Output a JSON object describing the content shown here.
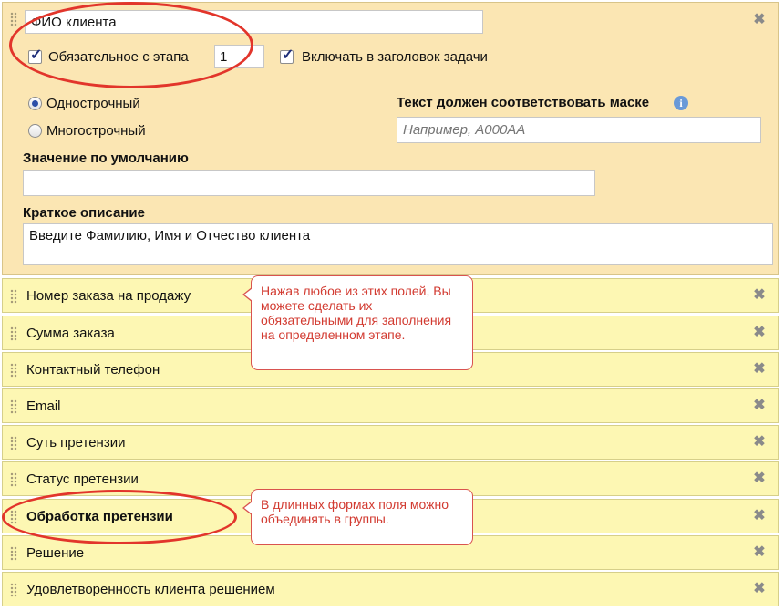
{
  "main_field": {
    "name": "ФИО клиента",
    "required_label": "Обязательное с этапа",
    "required_checked": true,
    "stage_value": "1",
    "include_title_label": "Включать в заголовок задачи",
    "include_title_checked": true,
    "single_line_label": "Однострочный",
    "multi_line_label": "Многострочный",
    "selected_line_mode": "single",
    "mask_label": "Текст должен соответствовать маске",
    "mask_placeholder": "Например, А000АА",
    "default_label": "Значение по умолчанию",
    "default_value": "",
    "description_label": "Краткое описание",
    "description_value": "Введите Фамилию, Имя и Отчество клиента",
    "close_glyph": "✖",
    "info_icon": "i"
  },
  "rows": [
    {
      "label": "Номер заказа на продажу",
      "bold": false
    },
    {
      "label": "Сумма заказа",
      "bold": false
    },
    {
      "label": "Контактный телефон",
      "bold": false
    },
    {
      "label": "Email",
      "bold": false
    },
    {
      "label": "Суть претензии",
      "bold": false
    },
    {
      "label": "Статус претензии",
      "bold": false
    },
    {
      "label": "Обработка претензии",
      "bold": true
    },
    {
      "label": "Решение",
      "bold": false
    },
    {
      "label": "Удовлетворенность клиента решением",
      "bold": false
    }
  ],
  "callouts": {
    "first": "Нажав любое из этих полей, Вы можете сделать их обязательными для заполнения на определенном этапе.",
    "second": "В длинных формах поля можно объединять в группы."
  },
  "colors": {
    "selected_panel": "#fbe6b3",
    "row_bg": "#fdf7b3",
    "annotation_red": "#e2352b"
  }
}
